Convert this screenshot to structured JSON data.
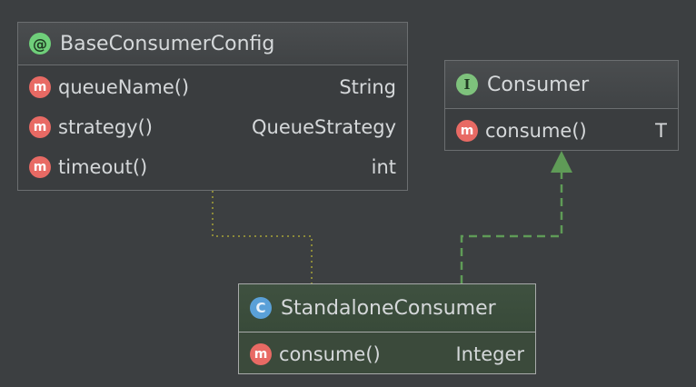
{
  "diagram": {
    "boxes": {
      "base_config": {
        "badge": "@",
        "icon": "annotation-icon",
        "title": "BaseConsumerConfig",
        "members": [
          {
            "badge": "m",
            "name": "queueName()",
            "type": "String"
          },
          {
            "badge": "m",
            "name": "strategy()",
            "type": "QueueStrategy"
          },
          {
            "badge": "m",
            "name": "timeout()",
            "type": "int"
          }
        ]
      },
      "consumer": {
        "badge": "I",
        "icon": "interface-icon",
        "title": "Consumer",
        "members": [
          {
            "badge": "m",
            "name": "consume()",
            "type": "T"
          }
        ]
      },
      "standalone": {
        "badge": "C",
        "icon": "class-icon",
        "title": "StandaloneConsumer",
        "members": [
          {
            "badge": "m",
            "name": "consume()",
            "type": "Integer"
          }
        ]
      }
    },
    "colors": {
      "background": "#3c3f41",
      "implements_line": "#5f9b57",
      "annotation_line": "#8c8a3a"
    }
  }
}
